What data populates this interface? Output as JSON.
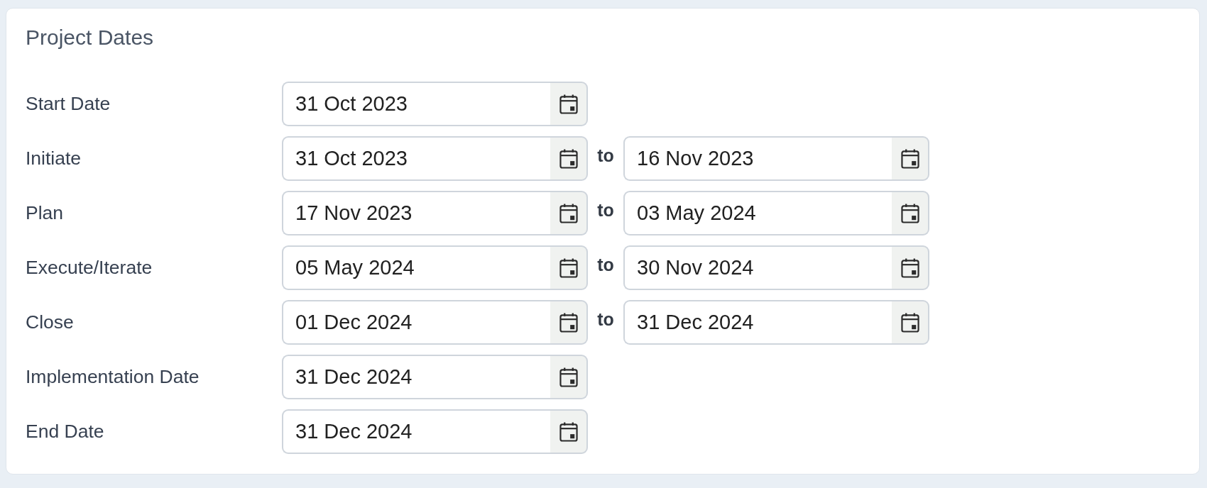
{
  "panel": {
    "title": "Project Dates"
  },
  "rows": [
    {
      "kind": "single",
      "label": "Start Date",
      "value": "31 Oct 2023"
    },
    {
      "kind": "range",
      "label": "Initiate",
      "start_value": "31 Oct 2023",
      "separator": "to",
      "end_value": "16 Nov 2023"
    },
    {
      "kind": "range",
      "label": "Plan",
      "start_value": "17 Nov 2023",
      "separator": "to",
      "end_value": "03 May 2024"
    },
    {
      "kind": "range",
      "label": "Execute/Iterate",
      "start_value": "05 May 2024",
      "separator": "to",
      "end_value": "30 Nov 2024"
    },
    {
      "kind": "range",
      "label": "Close",
      "start_value": "01 Dec 2024",
      "separator": "to",
      "end_value": "31 Dec 2024"
    },
    {
      "kind": "single",
      "label": "Implementation Date",
      "value": "31 Dec 2024"
    },
    {
      "kind": "single",
      "label": "End Date",
      "value": "31 Dec 2024"
    }
  ]
}
